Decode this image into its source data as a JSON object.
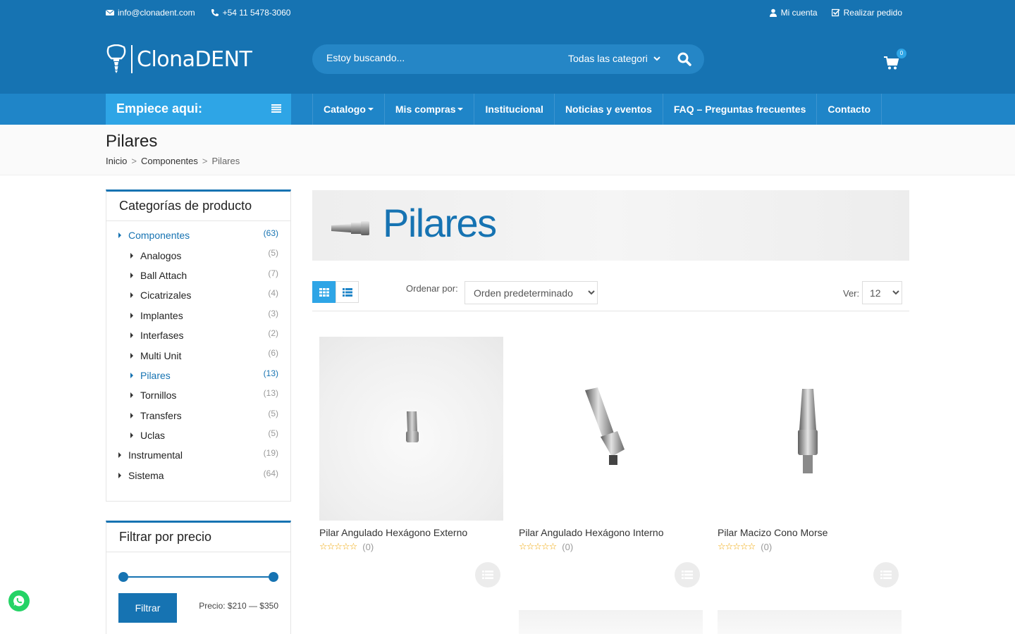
{
  "topbar": {
    "email": "info@clonadent.com",
    "phone": "+54 11 5478-3060",
    "account": "Mi cuenta",
    "order": "Realizar pedido"
  },
  "header": {
    "brand": "ClonaDENT",
    "search_placeholder": "Estoy buscando...",
    "category_select": "Todas las categori",
    "cart_count": "0"
  },
  "nav": {
    "start_label": "Empiece aqui:",
    "items": [
      {
        "label": "Catalogo"
      },
      {
        "label": "Mis compras"
      },
      {
        "label": "Institucional"
      },
      {
        "label": "Noticias y eventos"
      },
      {
        "label": "FAQ – Preguntas frecuentes"
      },
      {
        "label": "Contacto"
      }
    ]
  },
  "page": {
    "title": "Pilares",
    "breadcrumb": [
      "Inicio",
      "Componentes",
      "Pilares"
    ],
    "separator": ">"
  },
  "sidebar": {
    "categories_title": "Categorías de producto",
    "categories": [
      {
        "name": "Componentes",
        "count": "(63)"
      },
      {
        "name": "Analogos",
        "count": "(5)"
      },
      {
        "name": "Ball Attach",
        "count": "(7)"
      },
      {
        "name": "Cicatrizales",
        "count": "(4)"
      },
      {
        "name": "Implantes",
        "count": "(3)"
      },
      {
        "name": "Interfases",
        "count": "(2)"
      },
      {
        "name": "Multi Unit",
        "count": "(6)"
      },
      {
        "name": "Pilares",
        "count": "(13)"
      },
      {
        "name": "Tornillos",
        "count": "(13)"
      },
      {
        "name": "Transfers",
        "count": "(5)"
      },
      {
        "name": "Uclas",
        "count": "(5)"
      },
      {
        "name": "Instrumental",
        "count": "(19)"
      },
      {
        "name": "Sistema",
        "count": "(64)"
      }
    ],
    "price_title": "Filtrar por precio",
    "filter_button": "Filtrar",
    "price_text": "Precio: $210 — $350"
  },
  "main": {
    "banner_title": "Pilares",
    "sort_label": "Ordenar por:",
    "sort_value": "Orden predeterminado",
    "ver_label": "Ver:",
    "ver_value": "12",
    "products": [
      {
        "name": "Pilar Angulado Hexágono Externo",
        "reviews": "(0)",
        "stars": "☆☆☆☆☆"
      },
      {
        "name": "Pilar Angulado Hexágono Interno",
        "reviews": "(0)",
        "stars": "☆☆☆☆☆"
      },
      {
        "name": "Pilar Macizo Cono Morse",
        "reviews": "(0)",
        "stars": "☆☆☆☆☆"
      }
    ]
  },
  "colors": {
    "primary": "#1673b2",
    "accent": "#2ea5e6",
    "nav": "#1f85c8"
  }
}
